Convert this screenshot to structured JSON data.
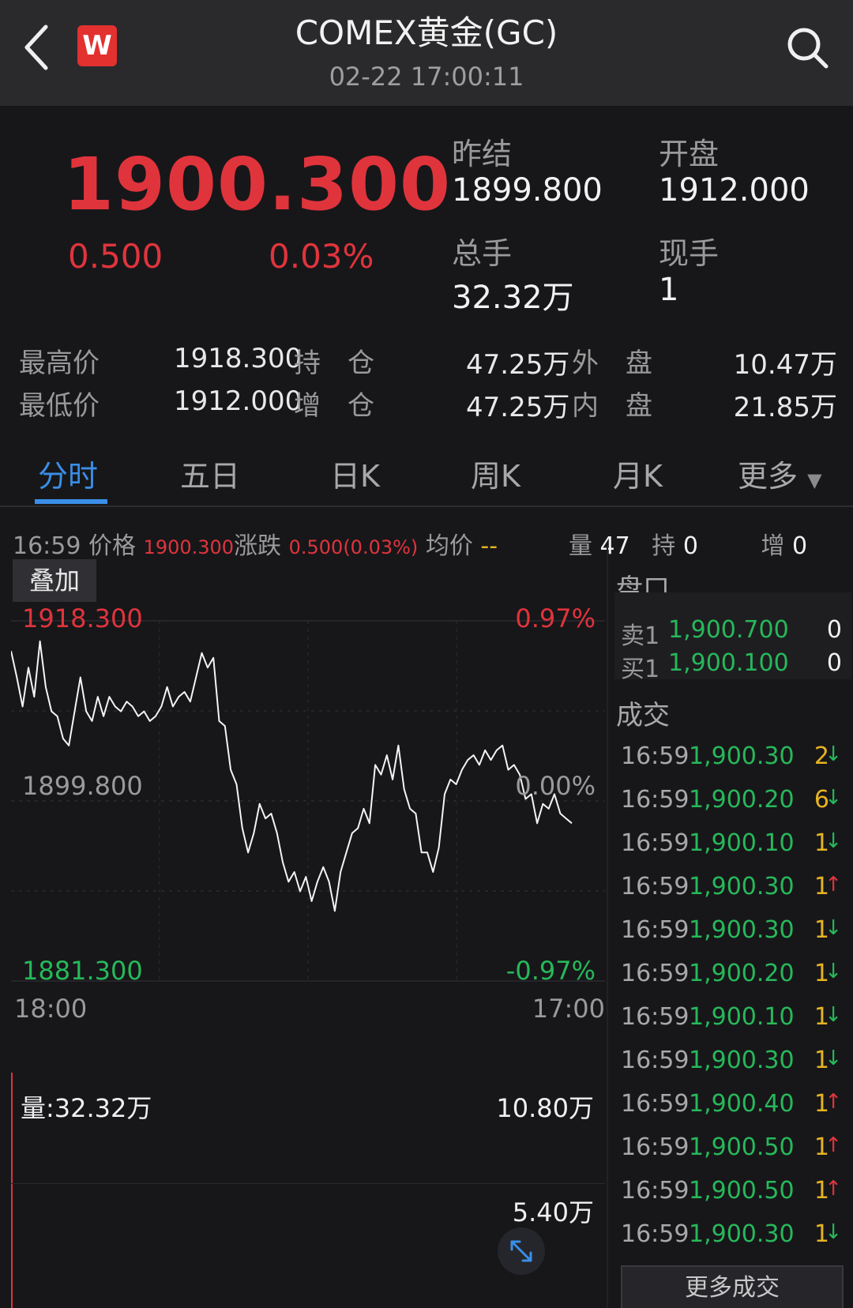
{
  "header": {
    "title": "COMEX黄金(GC)",
    "datetime": "02-22 17:00:11",
    "logo_text": "W"
  },
  "quote": {
    "price": "1900.300",
    "change": "0.500",
    "change_pct": "0.03%",
    "prev_settle_label": "昨结",
    "prev_settle": "1899.800",
    "open_label": "开盘",
    "open": "1912.000",
    "total_volume_label": "总手",
    "total_volume": "32.32万",
    "current_volume_label": "现手",
    "current_volume": "1"
  },
  "stats": {
    "high_label": "最高价",
    "high": "1918.300",
    "low_label": "最低价",
    "low": "1912.000",
    "open_interest_label": "持　仓",
    "open_interest": "47.25万",
    "oi_change_label": "增　仓",
    "oi_change": "47.25万",
    "outer_label": "外　盘",
    "outer": "10.47万",
    "inner_label": "内　盘",
    "inner": "21.85万"
  },
  "tabs": [
    "分时",
    "五日",
    "日K",
    "周K",
    "月K",
    "更多"
  ],
  "info_line": {
    "time_price_label": "16:59 价格",
    "price": "1900.300",
    "change_label": "涨跌",
    "change": "0.500(0.03%)",
    "avg_label": "均价",
    "avg": "--",
    "vol_label": "量",
    "vol": "47",
    "hold_label": "持",
    "hold": "0",
    "add_label": "增",
    "add": "0"
  },
  "overlay_button": "叠加",
  "chart": {
    "top_price": "1918.300",
    "top_pct": "0.97%",
    "mid_price": "1899.800",
    "mid_pct": "0.00%",
    "bottom_price": "1881.300",
    "bottom_pct": "-0.97%",
    "start_time": "18:00",
    "end_time": "17:00",
    "volume_label": "量:32.32万",
    "vol_max": "10.80万",
    "vol_mid": "5.40万"
  },
  "chart_data": {
    "type": "line",
    "title": "",
    "xlabel": "",
    "ylabel": "",
    "ylim": [
      1881.3,
      1918.3
    ],
    "reference": 1899.8,
    "x_range": [
      "18:00",
      "17:00"
    ],
    "series": [
      {
        "values": [
          1915.2,
          1912.5,
          1909.5,
          1913.5,
          1910.5,
          1916.2,
          1911.5,
          1909.0,
          1908.5,
          1906.2,
          1905.5,
          1909.0,
          1912.5,
          1909.0,
          1908.0,
          1910.5,
          1908.5,
          1910.5,
          1909.5,
          1909.0,
          1910.0,
          1909.5,
          1908.5,
          1909.0,
          1908.0,
          1908.5,
          1909.5,
          1911.5,
          1909.5,
          1910.5,
          1911.0,
          1910.0,
          1912.5,
          1915.0,
          1913.5,
          1914.5,
          1908.0,
          1907.5,
          1903.0,
          1901.5,
          1897.0,
          1894.5,
          1896.5,
          1899.5,
          1898.0,
          1898.5,
          1896.5,
          1893.5,
          1891.5,
          1892.5,
          1890.5,
          1892.0,
          1889.5,
          1891.5,
          1893.0,
          1891.5,
          1888.5,
          1892.5,
          1894.5,
          1896.5,
          1897.0,
          1899.0,
          1897.5,
          1903.5,
          1902.5,
          1904.5,
          1902.0,
          1905.5,
          1901.0,
          1899.0,
          1898.5,
          1894.5,
          1894.5,
          1892.5,
          1895.0,
          1900.5,
          1902.0,
          1901.5,
          1903.0,
          1904.0,
          1904.5,
          1903.5,
          1905.0,
          1904.0,
          1905.0,
          1905.5,
          1903.0,
          1903.5,
          1902.5,
          1900.0,
          1900.5,
          1897.5,
          1899.5,
          1899.0,
          1900.5,
          1898.5,
          1898.0,
          1897.5
        ]
      }
    ]
  },
  "order_book": {
    "title": "盘口",
    "rows": [
      {
        "label": "卖1",
        "price": "1,900.700",
        "qty": "0"
      },
      {
        "label": "买1",
        "price": "1,900.100",
        "qty": "0"
      }
    ]
  },
  "trades": {
    "title": "成交",
    "rows": [
      {
        "time": "16:59",
        "price": "1,900.30",
        "qty": "2",
        "dir": "down"
      },
      {
        "time": "16:59",
        "price": "1,900.20",
        "qty": "6",
        "dir": "down"
      },
      {
        "time": "16:59",
        "price": "1,900.10",
        "qty": "1",
        "dir": "down"
      },
      {
        "time": "16:59",
        "price": "1,900.30",
        "qty": "1",
        "dir": "up"
      },
      {
        "time": "16:59",
        "price": "1,900.30",
        "qty": "1",
        "dir": "down"
      },
      {
        "time": "16:59",
        "price": "1,900.20",
        "qty": "1",
        "dir": "down"
      },
      {
        "time": "16:59",
        "price": "1,900.10",
        "qty": "1",
        "dir": "down"
      },
      {
        "time": "16:59",
        "price": "1,900.30",
        "qty": "1",
        "dir": "down"
      },
      {
        "time": "16:59",
        "price": "1,900.40",
        "qty": "1",
        "dir": "up"
      },
      {
        "time": "16:59",
        "price": "1,900.50",
        "qty": "1",
        "dir": "up"
      },
      {
        "time": "16:59",
        "price": "1,900.50",
        "qty": "1",
        "dir": "up"
      },
      {
        "time": "16:59",
        "price": "1,900.30",
        "qty": "1",
        "dir": "down"
      }
    ],
    "more_label": "更多成交"
  },
  "colors": {
    "up": "#e0343c",
    "down": "#27b85a",
    "accent": "#3a8ee6",
    "qty_highlight": "#e6b422"
  }
}
